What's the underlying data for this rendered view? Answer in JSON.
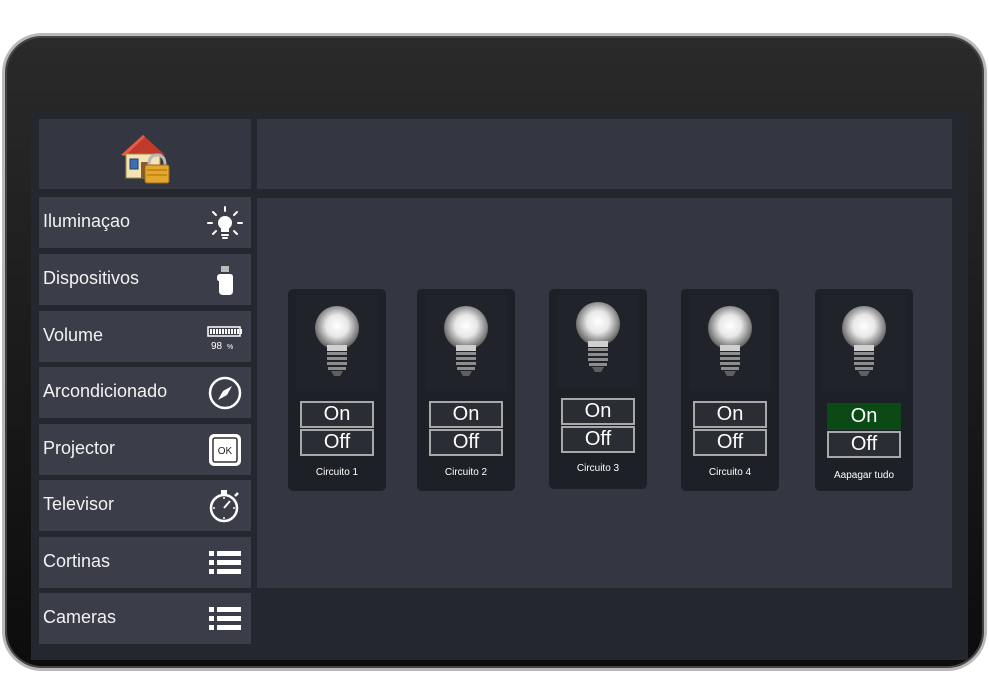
{
  "sidebar": {
    "items": [
      {
        "label": "Iluminaçao",
        "icon": "lightbulb-icon"
      },
      {
        "label": "Dispositivos",
        "icon": "hand-pointer-icon"
      },
      {
        "label": "Volume",
        "icon": "volume-level-icon",
        "value": "98",
        "unit": "%"
      },
      {
        "label": "Arcondicionado",
        "icon": "compass-icon"
      },
      {
        "label": "Projector",
        "icon": "ok-button-icon",
        "icon_text": "OK"
      },
      {
        "label": "Televisor",
        "icon": "stopwatch-icon"
      },
      {
        "label": "Cortinas",
        "icon": "list-icon"
      },
      {
        "label": "Cameras",
        "icon": "list-icon"
      }
    ]
  },
  "logo": {
    "icon": "house-lock-icon"
  },
  "circuits": [
    {
      "name": "Circuito 1",
      "on_label": "On",
      "off_label": "Off",
      "state": "off"
    },
    {
      "name": "Circuito 2",
      "on_label": "On",
      "off_label": "Off",
      "state": "off"
    },
    {
      "name": "Circuito 3",
      "on_label": "On",
      "off_label": "Off",
      "state": "off"
    },
    {
      "name": "Circuito 4",
      "on_label": "On",
      "off_label": "Off",
      "state": "off"
    },
    {
      "name": "Aapagar tudo",
      "on_label": "On",
      "off_label": "Off",
      "state": "on"
    }
  ],
  "colors": {
    "screen_bg": "#24272e",
    "panel_bg": "#343741",
    "menu_bg": "#3b3e48",
    "card_bg": "#1d2026",
    "active_green": "#0b4a15"
  }
}
